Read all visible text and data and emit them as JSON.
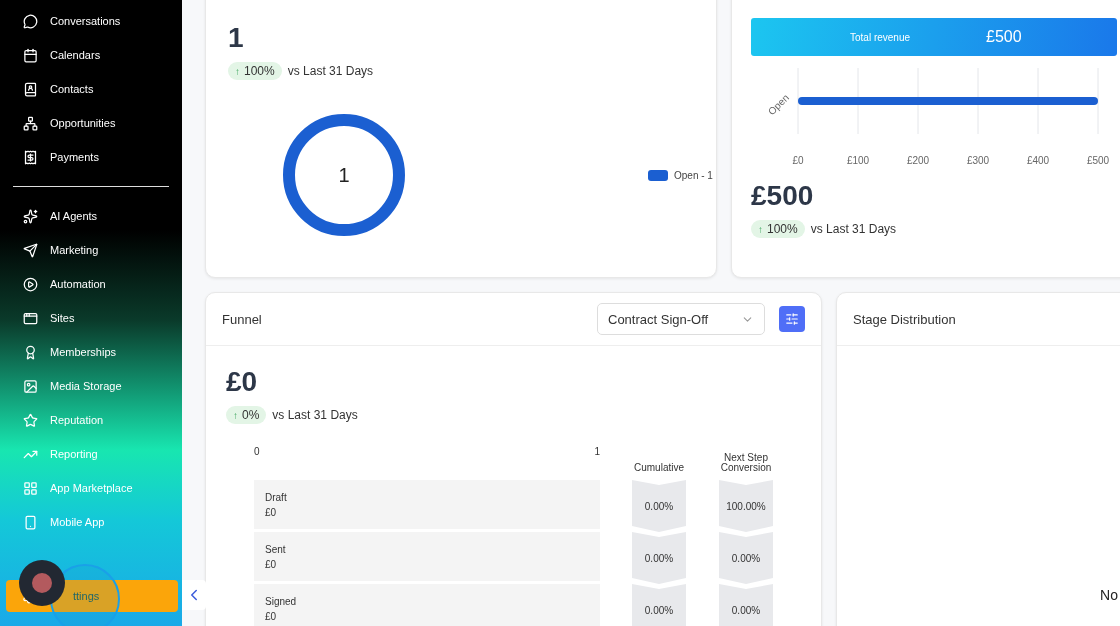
{
  "sidebar": {
    "sections": [
      [
        {
          "label": "Conversations"
        },
        {
          "label": "Calendars"
        },
        {
          "label": "Contacts"
        },
        {
          "label": "Opportunities"
        },
        {
          "label": "Payments"
        }
      ],
      [
        {
          "label": "AI Agents"
        },
        {
          "label": "Marketing"
        },
        {
          "label": "Automation"
        },
        {
          "label": "Sites"
        },
        {
          "label": "Memberships"
        },
        {
          "label": "Media Storage"
        },
        {
          "label": "Reputation"
        },
        {
          "label": "Reporting"
        },
        {
          "label": "App Marketplace"
        },
        {
          "label": "Mobile App"
        }
      ]
    ],
    "settings_button": {
      "label": "ttings"
    }
  },
  "opportunities_card": {
    "value": "1",
    "change": {
      "arrow": "↑",
      "percent": "100%"
    },
    "comparison": "vs Last 31 Days",
    "center_label": "1",
    "legend": [
      {
        "label": "Open - 1",
        "color": "#1b5fd1"
      }
    ]
  },
  "revenue_card": {
    "banner": {
      "label": "Total revenue",
      "value": "£500"
    },
    "chart_data": {
      "type": "bar",
      "orientation": "horizontal",
      "grid": true,
      "categories": [
        "Open"
      ],
      "values": [
        500
      ],
      "xlim": [
        0,
        500
      ],
      "xticks": [
        {
          "value": 0,
          "label": "£0"
        },
        {
          "value": 100,
          "label": "£100"
        },
        {
          "value": 200,
          "label": "£200"
        },
        {
          "value": 300,
          "label": "£300"
        },
        {
          "value": 400,
          "label": "£400"
        },
        {
          "value": 500,
          "label": "£500"
        }
      ]
    },
    "value": "£500",
    "change": {
      "arrow": "↑",
      "percent": "100%"
    },
    "comparison": "vs Last 31 Days"
  },
  "funnel_card": {
    "title": "Funnel",
    "dropdown": {
      "value": "Contract Sign-Off"
    },
    "value": "£0",
    "change": {
      "arrow": "↑",
      "percent": "0%"
    },
    "comparison": "vs Last 31 Days",
    "axis": [
      "0",
      "1"
    ],
    "columns": [
      "Cumulative",
      "Next Step Conversion"
    ],
    "stages": [
      {
        "name": "Draft",
        "amount": "£0",
        "cumulative": "0.00%",
        "next_step": "100.00%"
      },
      {
        "name": "Sent",
        "amount": "£0",
        "cumulative": "0.00%",
        "next_step": "0.00%"
      },
      {
        "name": "Signed",
        "amount": "£0",
        "cumulative": "0.00%",
        "next_step": "0.00%"
      }
    ]
  },
  "stage_distribution_card": {
    "title": "Stage Distribution",
    "message": "No"
  }
}
